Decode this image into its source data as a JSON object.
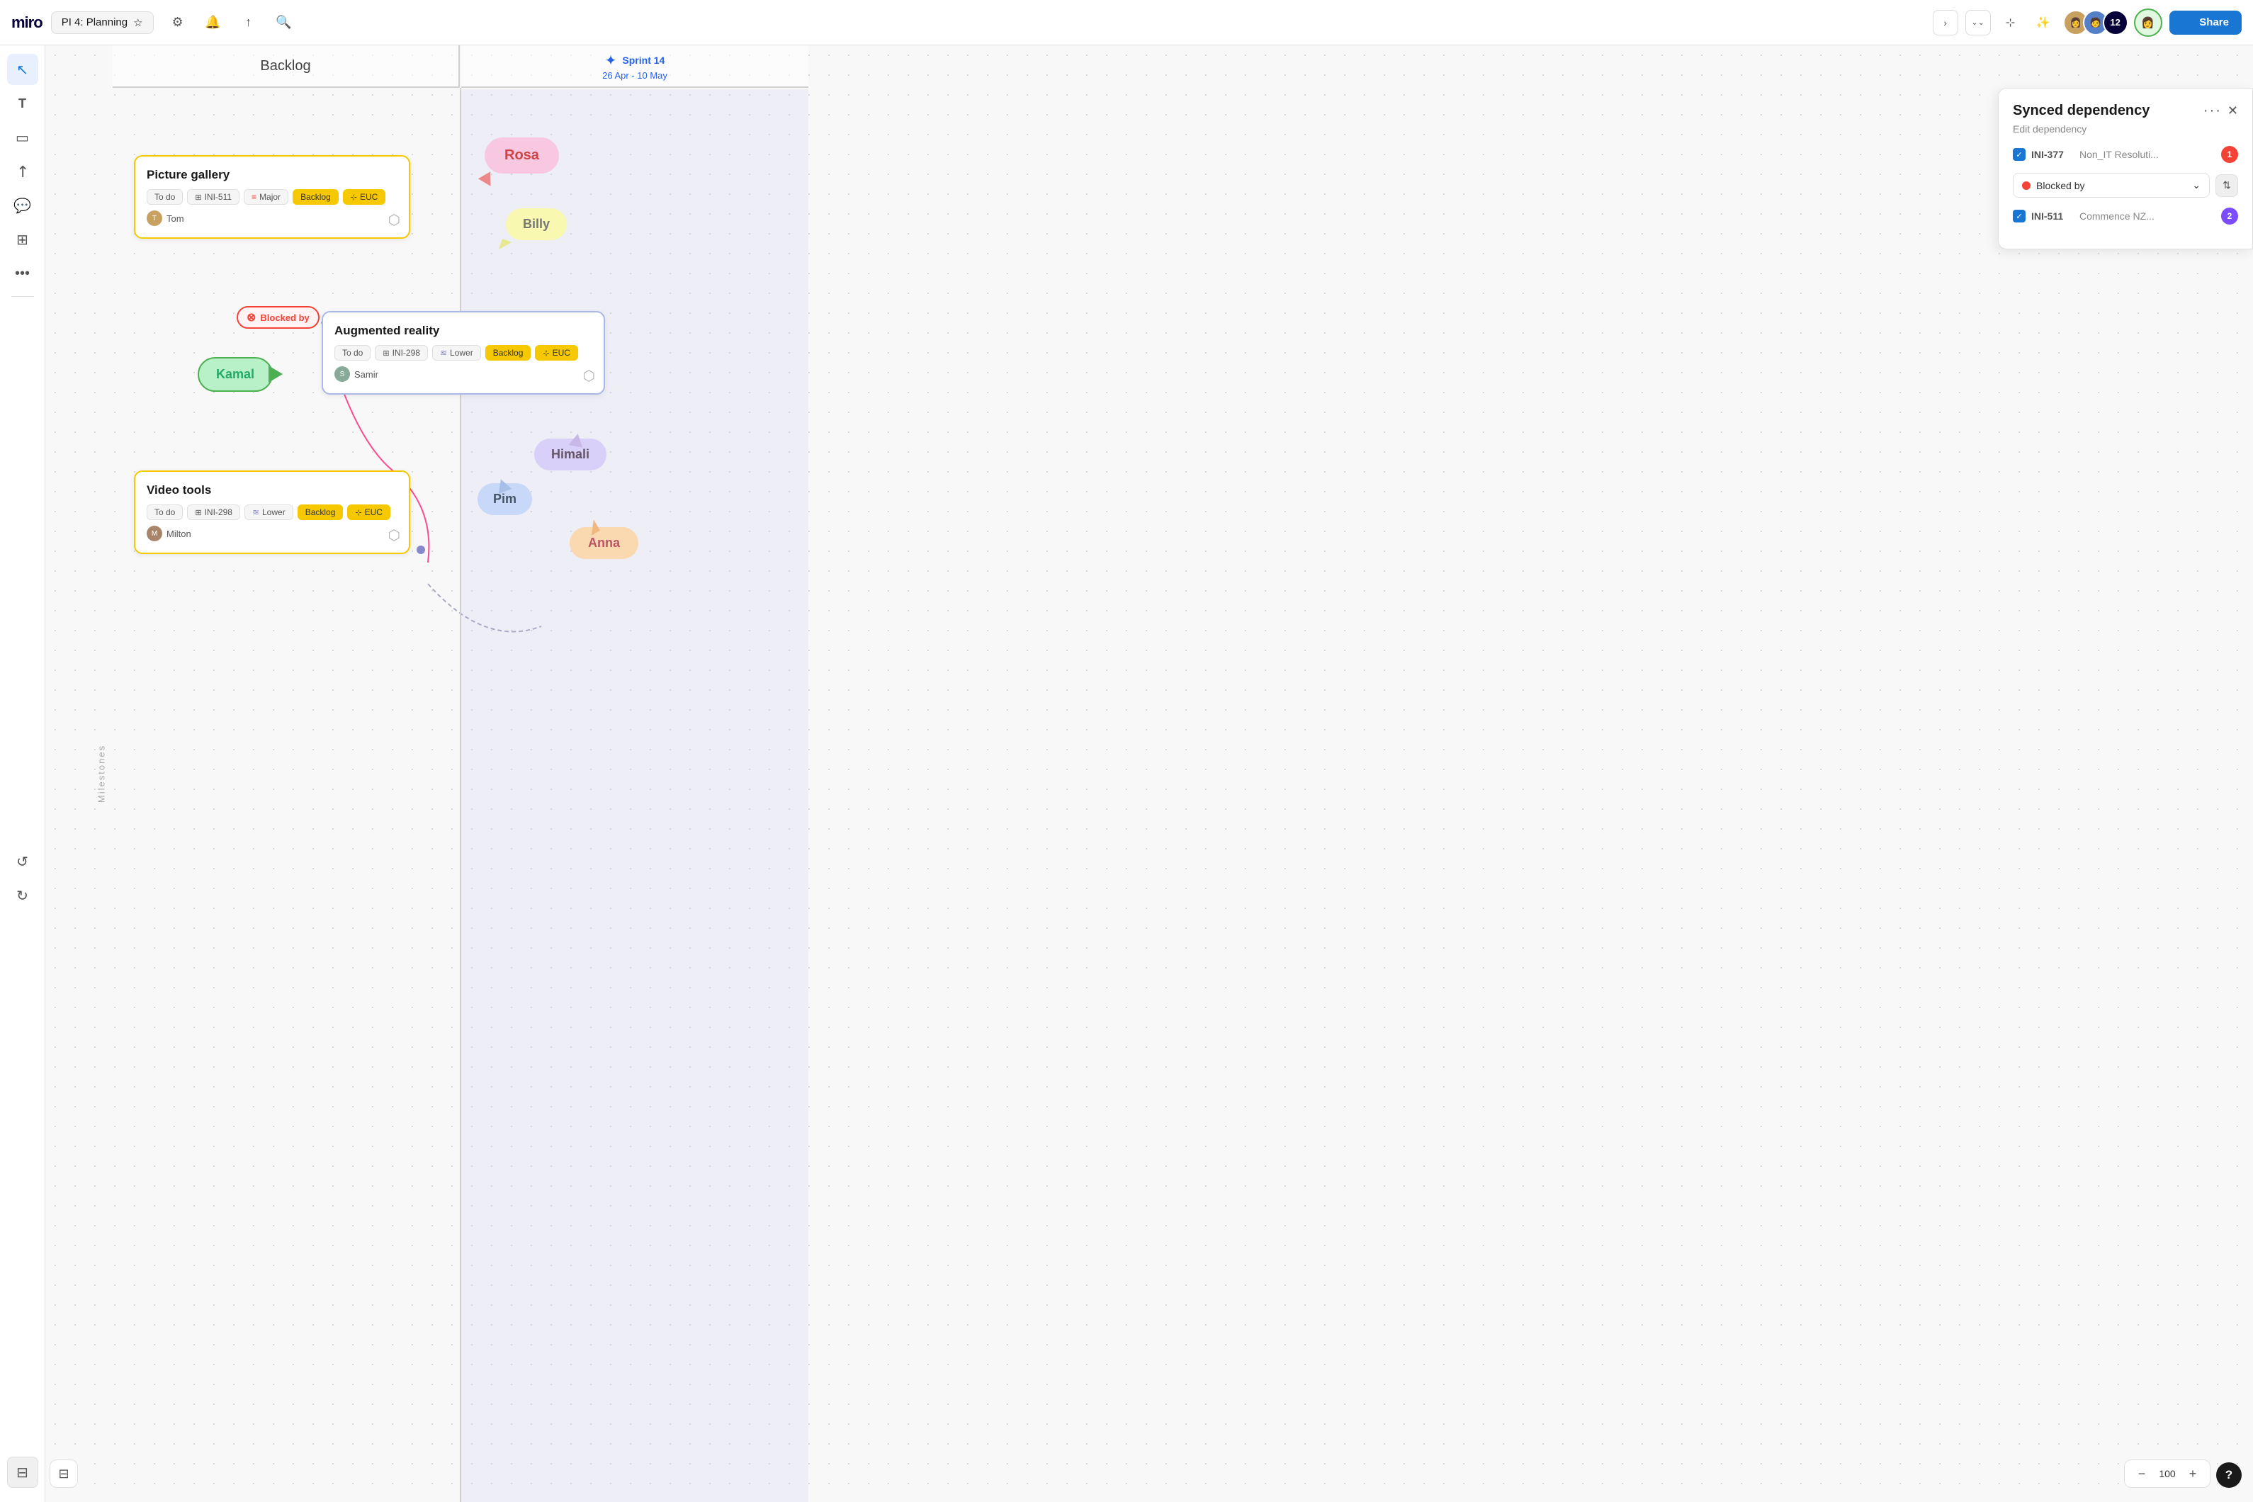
{
  "topbar": {
    "logo": "miro",
    "project": "PI 4: Planning",
    "icons": [
      "settings",
      "notification",
      "upload",
      "search"
    ],
    "avatar_count": "12",
    "share_label": "Share",
    "nav_forward": "›",
    "nav_expand": "⌄⌄"
  },
  "toolbar": {
    "tools": [
      "cursor",
      "text",
      "sticky",
      "arrow",
      "comment",
      "frame",
      "more"
    ],
    "undo": "↺",
    "redo": "↻"
  },
  "canvas": {
    "backlog_label": "Backlog",
    "milestones_label": "Milestones",
    "sprint_label": "Sprint 14",
    "sprint_dates": "26 Apr - 10 May"
  },
  "cards": {
    "picture_gallery": {
      "title": "Picture gallery",
      "status": "To do",
      "ticket": "INI-511",
      "priority": "Major",
      "tag1": "Backlog",
      "tag2": "EUC",
      "user": "Tom"
    },
    "augmented_reality": {
      "title": "Augmented reality",
      "status": "To do",
      "ticket": "INI-298",
      "priority": "Lower",
      "tag1": "Backlog",
      "tag2": "EUC",
      "user": "Samir"
    },
    "video_tools": {
      "title": "Video tools",
      "status": "To do",
      "ticket": "INI-298",
      "priority": "Lower",
      "tag1": "Backlog",
      "tag2": "EUC",
      "user": "Milton"
    }
  },
  "blocked": {
    "label": "Blocked by"
  },
  "people": [
    {
      "name": "Rosa",
      "style": "pink"
    },
    {
      "name": "Billy",
      "style": "yellow"
    },
    {
      "name": "Kamal",
      "style": "green"
    },
    {
      "name": "Himali",
      "style": "purple"
    },
    {
      "name": "Pim",
      "style": "blue"
    },
    {
      "name": "Anna",
      "style": "orange"
    }
  ],
  "dep_panel": {
    "title": "Synced dependency",
    "subtitle": "Edit dependency",
    "item1_id": "INI-377",
    "item1_desc": "Non_IT Resoluti...",
    "item1_badge": "1",
    "blocked_label": "Blocked by",
    "item2_id": "INI-511",
    "item2_desc": "Commence NZ...",
    "item2_badge": "2"
  },
  "zoom": {
    "value": "100",
    "minus": "−",
    "plus": "+"
  }
}
